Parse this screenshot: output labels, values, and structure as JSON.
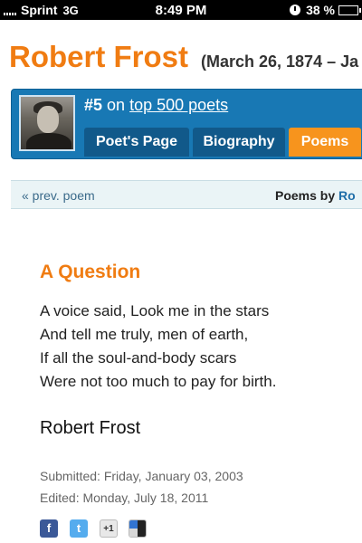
{
  "status_bar": {
    "carrier": "Sprint",
    "network": "3G",
    "time": "8:49 PM",
    "battery": "38 %",
    "battery_level": 0.38
  },
  "poet": {
    "name": "Robert Frost",
    "dates": "(March 26, 1874 – Ja",
    "rank": "#5",
    "rank_suffix": "on",
    "rank_link": "top 500 poets"
  },
  "tabs": [
    {
      "label": "Poet's Page",
      "active": false
    },
    {
      "label": "Biography",
      "active": false
    },
    {
      "label": "Poems",
      "active": true
    }
  ],
  "poem_nav": {
    "prev": "« prev. poem",
    "poems_by": "Poems by",
    "poems_by_author": "Ro"
  },
  "poem": {
    "title": "A Question",
    "lines": [
      "A voice said, Look me in the stars",
      "And tell me truly, men of earth,",
      "If all the soul-and-body scars",
      "Were not too much to pay for birth."
    ],
    "author": "Robert Frost",
    "submitted": "Submitted: Friday, January 03, 2003",
    "edited": "Edited: Monday, July 18, 2011"
  },
  "share": {
    "facebook_glyph": "f",
    "twitter_glyph": "t",
    "google_plus_glyph": "+1"
  },
  "colors": {
    "accent_orange": "#f07c12",
    "header_blue": "#1878b4",
    "tab_active": "#f7941d"
  }
}
